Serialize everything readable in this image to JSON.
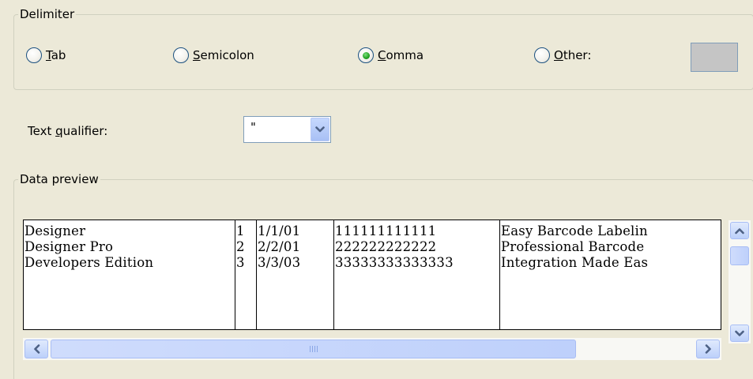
{
  "delimiter": {
    "title": "Delimiter",
    "options": [
      {
        "label": "Tab",
        "mnemonic": "T",
        "rest": "ab",
        "selected": false
      },
      {
        "label": "Semicolon",
        "mnemonic": "S",
        "rest": "emicolon",
        "selected": false
      },
      {
        "label": "Comma",
        "mnemonic": "C",
        "rest": "omma",
        "selected": true
      },
      {
        "label": "Other:",
        "mnemonic": "O",
        "rest": "ther:",
        "selected": false
      }
    ],
    "other_value": ""
  },
  "text_qualifier": {
    "label_before": "Text ",
    "mnemonic": "q",
    "label_after": "ualifier:",
    "value": "\""
  },
  "preview": {
    "title": "Data preview",
    "columns": [
      [
        "Designer",
        "Designer Pro",
        "Developers Edition"
      ],
      [
        "1",
        "2",
        "3"
      ],
      [
        "1/1/01",
        "2/2/01",
        "3/3/03"
      ],
      [
        "111111111111",
        "222222222222",
        "33333333333333"
      ],
      [
        "Easy Barcode Labelin",
        "Professional Barcode",
        "Integration Made Eas"
      ]
    ]
  },
  "icons": {
    "combo_arrow": "chevron-down-icon",
    "scroll_up": "scroll-up-arrow-icon",
    "scroll_down": "scroll-down-arrow-icon",
    "scroll_left": "scroll-left-arrow-icon",
    "scroll_right": "scroll-right-arrow-icon"
  },
  "colors": {
    "background": "#ece9d8",
    "radio_selected": "#21a121",
    "scroll_accent": "#4d6185"
  }
}
